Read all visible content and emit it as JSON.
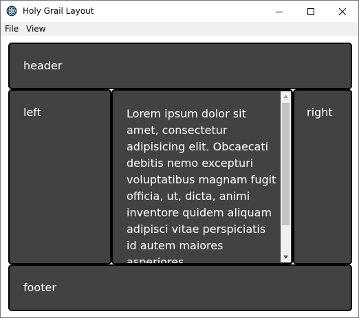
{
  "window": {
    "title": "Holy Grail Layout",
    "icon": "electron-atom-icon"
  },
  "menu": {
    "file": "File",
    "view": "View"
  },
  "layout": {
    "header": "header",
    "left": "left",
    "main": "Lorem ipsum dolor sit amet, consectetur adipisicing elit. Obcaecati debitis nemo excepturi voluptatibus magnam fugit officia, ut, dicta, animi inventore quidem aliquam adipisci vitae perspiciatis id autem maiores asperiores",
    "right": "right",
    "footer": "footer"
  },
  "colors": {
    "panel_background": "#424242",
    "panel_border": "#000000",
    "panel_text": "#ffffff",
    "menu_background": "#f0f0f0"
  }
}
